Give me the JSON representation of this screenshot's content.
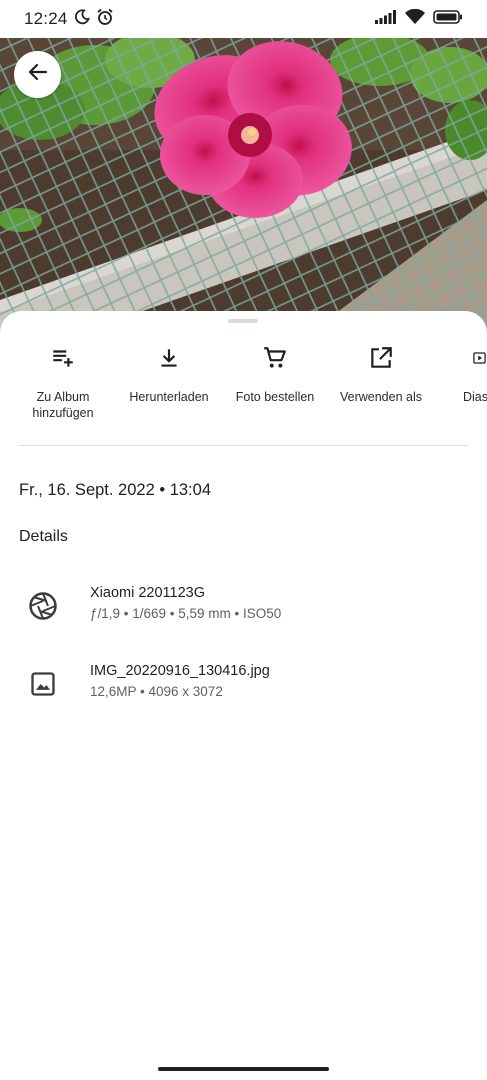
{
  "status_bar": {
    "time": "12:24",
    "icons": [
      "moon-icon",
      "alarm-icon",
      "signal-icon",
      "wifi-icon",
      "battery-icon"
    ]
  },
  "photo": {
    "subject": "pink hibiscus flower"
  },
  "toolbar": {
    "back_icon": "arrow-left-icon"
  },
  "actions": [
    {
      "label": "Zu Album hinzufügen",
      "icon": "playlist-add-icon"
    },
    {
      "label": "Herunterladen",
      "icon": "download-icon"
    },
    {
      "label": "Foto bestellen",
      "icon": "shopping-cart-icon"
    },
    {
      "label": "Verwenden als",
      "icon": "open-in-new-icon"
    },
    {
      "label": "Dias",
      "icon": "slideshow-icon"
    }
  ],
  "info": {
    "date_time": "Fr., 16. Sept. 2022 • 13:04",
    "details_heading": "Details"
  },
  "details": {
    "camera": {
      "title": "Xiaomi 2201123G",
      "subtitle": "ƒ/1,9 • 1/669 • 5,59 mm • ISO50",
      "icon": "camera-aperture-icon"
    },
    "file": {
      "title": "IMG_20220916_130416.jpg",
      "subtitle": "12,6MP • 4096 x 3072",
      "icon": "image-icon"
    }
  },
  "colors": {
    "flower_pink": "#e43f8c",
    "sheet_background": "#ffffff",
    "text_primary": "#1f1f1f",
    "text_secondary": "#5f5f5f"
  }
}
